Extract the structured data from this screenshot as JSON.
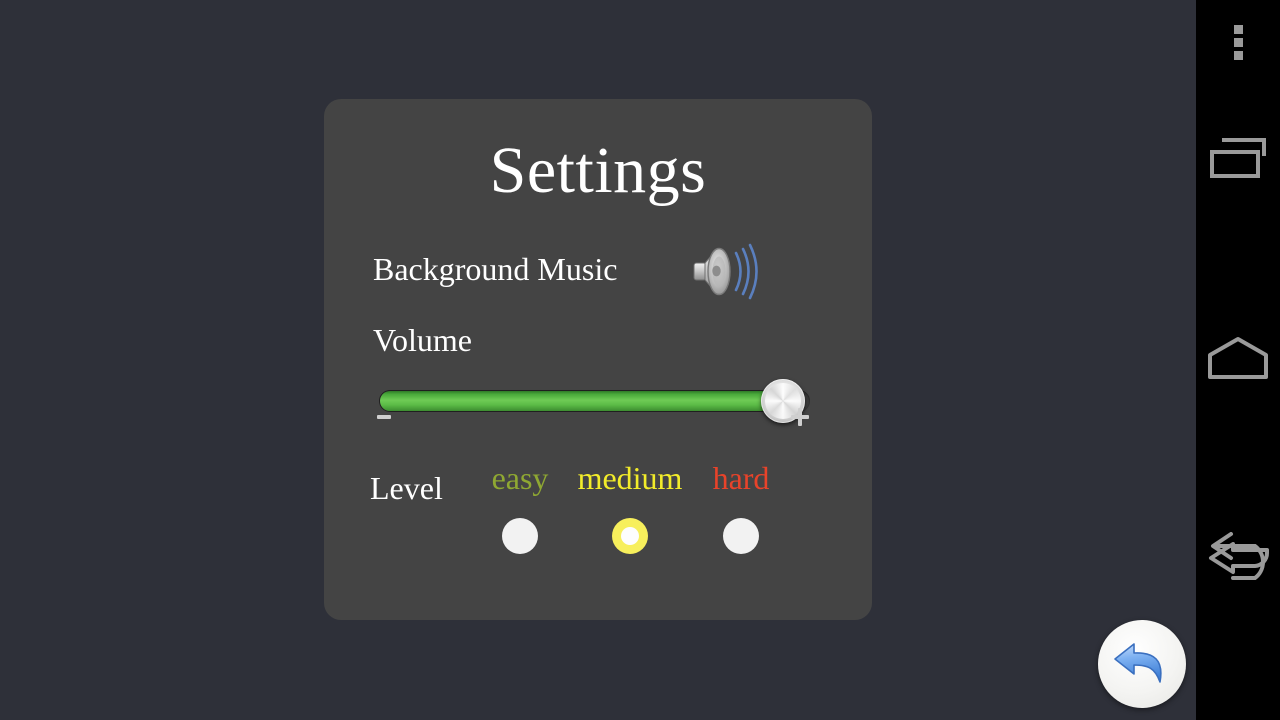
{
  "window": {
    "background_color": "#2e3039",
    "card_color": "#444444"
  },
  "settings": {
    "title": "Settings",
    "background_music": {
      "label": "Background Music",
      "icon": "speaker-on-icon",
      "enabled": true
    },
    "volume": {
      "label": "Volume",
      "value": 100,
      "min": 0,
      "max": 100,
      "decrease_icon": "minus-icon",
      "increase_icon": "plus-icon",
      "fill_color": "#5bbb46"
    },
    "level": {
      "label": "Level",
      "selected": "medium",
      "options": [
        {
          "label": "easy",
          "color": "#8fa832",
          "selected": false
        },
        {
          "label": "medium",
          "color": "#f2ec2a",
          "selected": true
        },
        {
          "label": "hard",
          "color": "#e8432a",
          "selected": false
        }
      ]
    }
  },
  "floating_button": {
    "name": "back-button",
    "icon": "undo-arrow-icon",
    "color": "#6ba6ef"
  },
  "android_navbar": {
    "buttons": [
      {
        "name": "overflow-menu",
        "icon": "three-dots-icon"
      },
      {
        "name": "recents",
        "icon": "recents-icon"
      },
      {
        "name": "home",
        "icon": "home-icon"
      },
      {
        "name": "back",
        "icon": "back-arrow-icon"
      }
    ],
    "icon_color": "#9a9a9a"
  }
}
